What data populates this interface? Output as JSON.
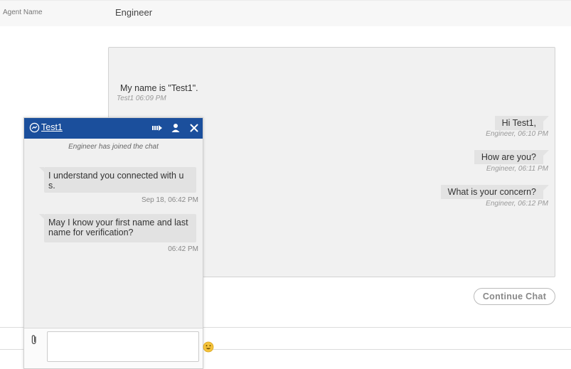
{
  "agent": {
    "label": "Agent Name",
    "value": "Engineer"
  },
  "transcript": {
    "customer_message": {
      "text": "My name is \"Test1\".",
      "meta": "Test1 06:09 PM"
    },
    "agent_messages": [
      {
        "text": "Hi Test1,",
        "meta": "Engineer, 06:10 PM"
      },
      {
        "text": "How are you?",
        "meta": "Engineer, 06:11 PM"
      },
      {
        "text": "What is your concern?",
        "meta": "Engineer, 06:12 PM"
      }
    ]
  },
  "continue_chat_label": "Continue Chat",
  "widget": {
    "title": "Test1",
    "accent_color": "#1b4f9c",
    "header_icons": [
      "transfer-icon",
      "user-icon",
      "close-icon"
    ],
    "system_note": "Engineer has joined the chat",
    "messages": [
      {
        "text": "I understand you connected with u s.",
        "time": "Sep 18, 06:42 PM"
      },
      {
        "text": "May I know your first name and last name for verification?",
        "time": "06:42 PM"
      }
    ],
    "input_placeholder": "",
    "attach_icon": "paperclip-icon",
    "emoji_icon": "smiley-emoji-icon"
  }
}
